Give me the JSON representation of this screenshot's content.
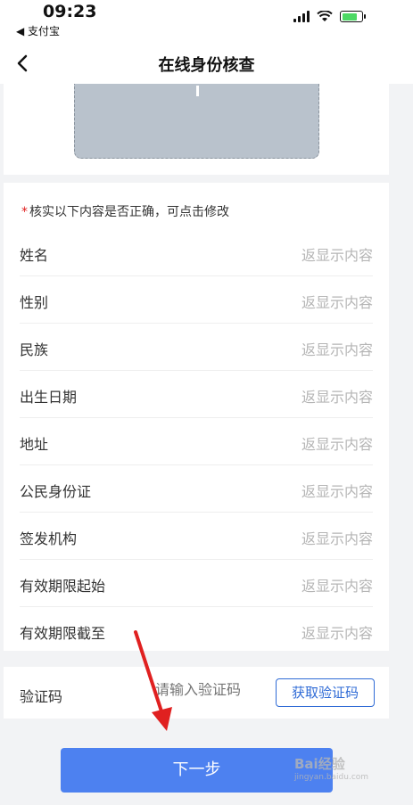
{
  "status_bar": {
    "time": "09:23",
    "back_app": "◀ 支付宝"
  },
  "nav": {
    "back_icon": "chevron-left",
    "title": "在线身份核查"
  },
  "notice": {
    "star": "*",
    "text": "核实以下内容是否正确，可点击修改"
  },
  "fields": [
    {
      "label": "姓名",
      "value": "返显示内容"
    },
    {
      "label": "性别",
      "value": "返显示内容"
    },
    {
      "label": "民族",
      "value": "返显示内容"
    },
    {
      "label": "出生日期",
      "value": "返显示内容"
    },
    {
      "label": "地址",
      "value": "返显示内容"
    },
    {
      "label": "公民身份证",
      "value": "返显示内容"
    },
    {
      "label": "签发机构",
      "value": "返显示内容"
    },
    {
      "label": "有效期限起始",
      "value": "返显示内容"
    },
    {
      "label": "有效期限截至",
      "value": "返显示内容"
    }
  ],
  "verify": {
    "label": "验证码",
    "placeholder": "请输入验证码",
    "get_code_label": "获取验证码"
  },
  "next_button": "下一步",
  "watermark": {
    "main": "Bai经验",
    "sub": "jingyan.baidu.com"
  },
  "colors": {
    "accent": "#4d81f0",
    "link": "#2f6bd6",
    "required": "#e02020",
    "annotation": "#e02020"
  }
}
